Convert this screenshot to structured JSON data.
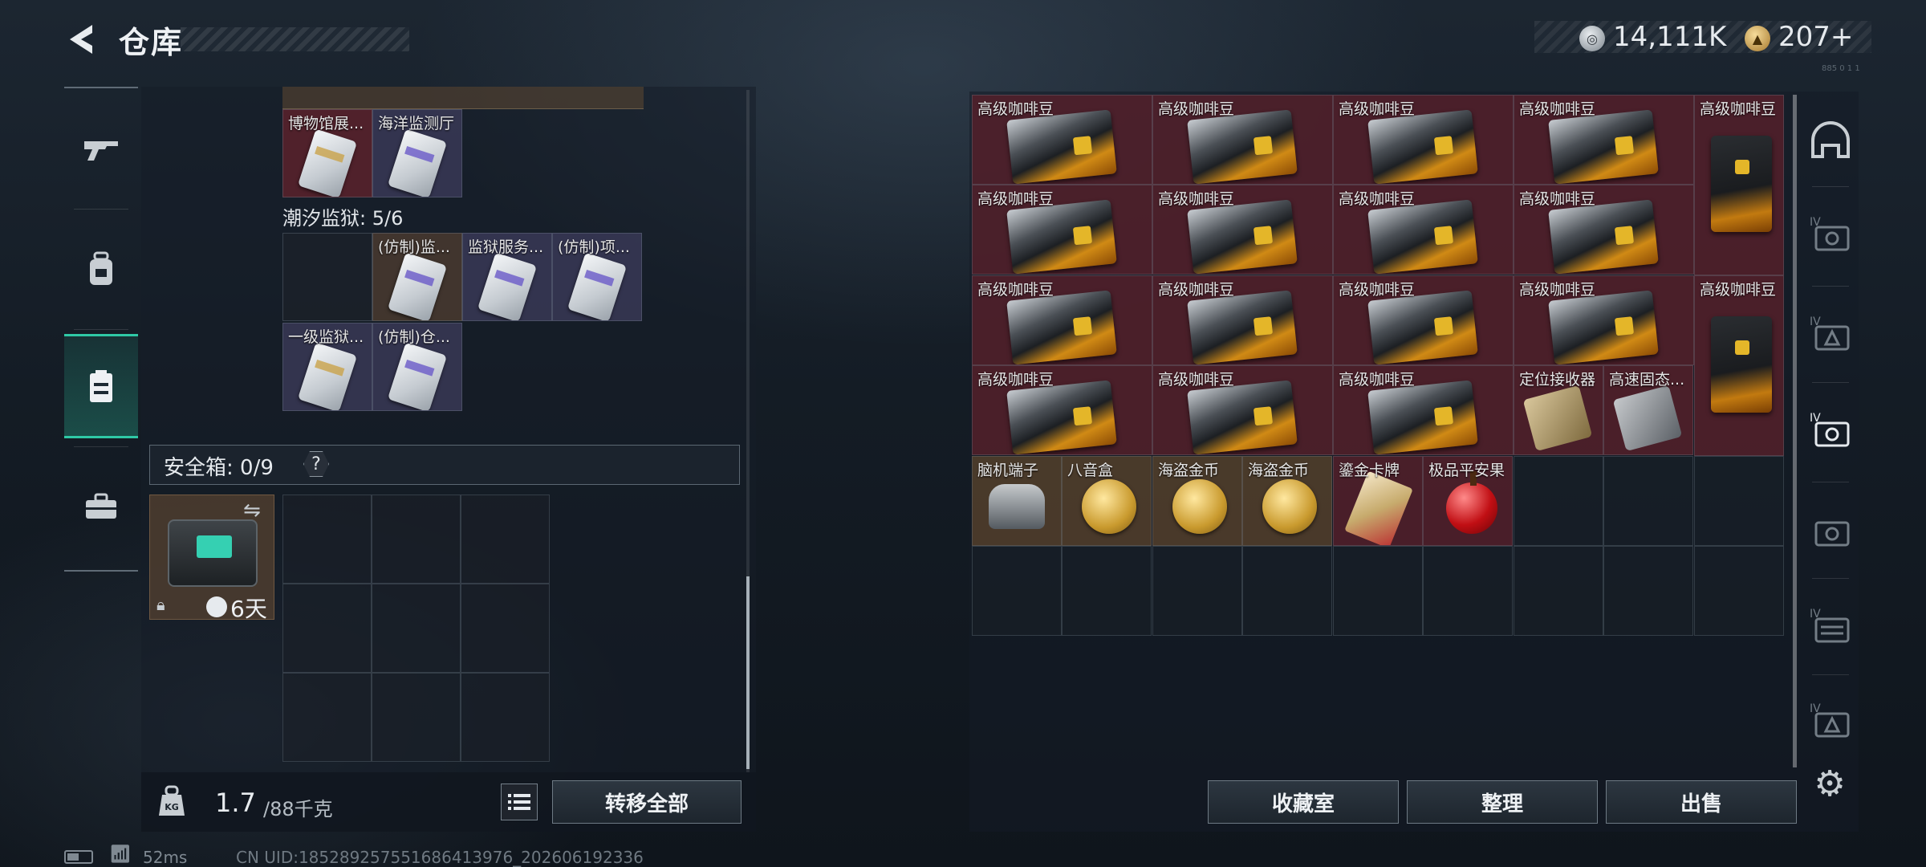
{
  "header": {
    "title": "仓库",
    "silver_amount": "14,111K",
    "gold_amount": "207+",
    "corner_code": "885 0 1 1"
  },
  "left_nav": {
    "items": [
      "weapon-icon",
      "backpack-icon",
      "storage-icon",
      "briefcase-icon"
    ],
    "active": "storage-icon"
  },
  "keycards": {
    "top_row": [
      {
        "label": "博物馆展...",
        "color": "red"
      },
      {
        "label": "海洋监测厅",
        "color": "purple"
      }
    ],
    "prison_title": "潮汐监狱: 5/6",
    "prison_cells": [
      {
        "label": "",
        "color": "empty"
      },
      {
        "label": "(仿制)监...",
        "color": "brown"
      },
      {
        "label": "监狱服务...",
        "color": "purple"
      },
      {
        "label": "(仿制)项...",
        "color": "purple"
      },
      {
        "label": "一级监狱...",
        "color": "purple"
      },
      {
        "label": "(仿制)仓...",
        "color": "purple"
      }
    ]
  },
  "safe": {
    "label": "安全箱: 0/9",
    "help": "?",
    "days": "6天"
  },
  "weight": {
    "current": "1.7",
    "max": "/88千克"
  },
  "buttons": {
    "transfer_all": "转移全部",
    "collection": "收藏室",
    "sort": "整理",
    "sell": "出售"
  },
  "inventory": {
    "items": [
      {
        "label": "高级咖啡豆"
      },
      {
        "label": "高级咖啡豆"
      },
      {
        "label": "高级咖啡豆"
      },
      {
        "label": "高级咖啡豆"
      },
      {
        "label": "高级咖啡豆"
      },
      {
        "label": "高级咖啡豆"
      },
      {
        "label": "高级咖啡豆"
      },
      {
        "label": "高级咖啡豆"
      },
      {
        "label": "高级咖啡豆"
      },
      {
        "label": "高级咖啡豆"
      },
      {
        "label": "高级咖啡豆"
      },
      {
        "label": "高级咖啡豆"
      },
      {
        "label": "高级咖啡豆"
      },
      {
        "label": "高级咖啡豆"
      },
      {
        "label": "高级咖啡豆"
      },
      {
        "label": "高级咖啡豆"
      },
      {
        "label": "高级咖啡豆"
      },
      {
        "label": "定位接收器"
      },
      {
        "label": "高速固态..."
      },
      {
        "label": "脑机端子"
      },
      {
        "label": "八音盒"
      },
      {
        "label": "海盗金币"
      },
      {
        "label": "海盗金币"
      },
      {
        "label": "鎏金卡牌"
      },
      {
        "label": "极品平安果"
      }
    ]
  },
  "right_rail": {
    "items": [
      "helmet-icon",
      "armor-iv-icon",
      "rig-iv-icon",
      "backpack-iv-icon",
      "armor-icon",
      "case-iv-icon",
      "box-iv-icon"
    ]
  },
  "status": {
    "ping": "52ms",
    "uid": "CN UID:1852892575516864139​76_202606192336"
  }
}
